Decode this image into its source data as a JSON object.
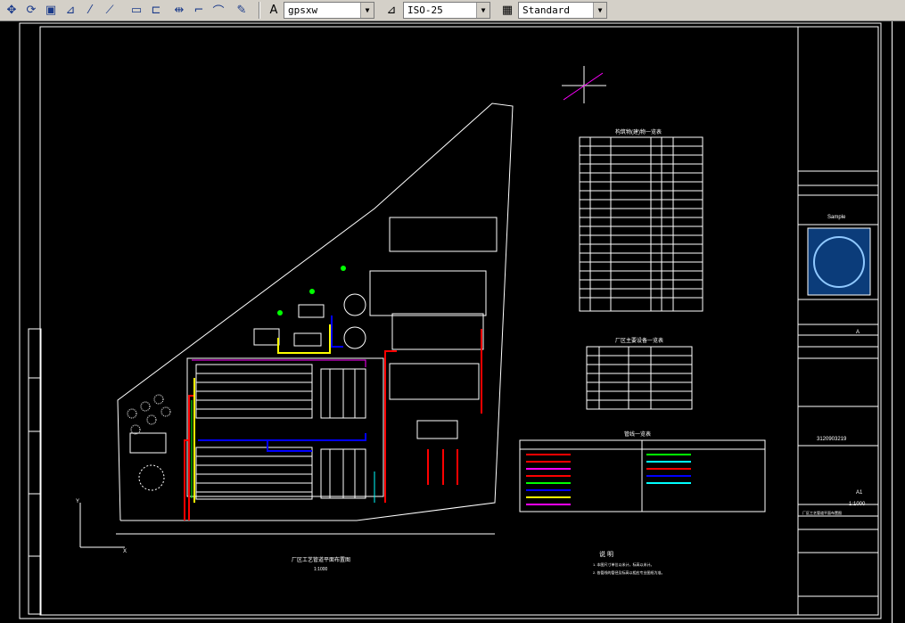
{
  "toolbar": {
    "icons": [
      "pan-icon",
      "orbit-icon",
      "region-icon",
      "measure-icon",
      "line-icon",
      "polyline-icon",
      "rectangle-icon",
      "rectangle-alt-icon",
      "trim-icon",
      "extend-icon",
      "arc-icon",
      "paint-icon"
    ],
    "text_style": "gpsxw",
    "dim_style": "ISO-25",
    "table_style": "Standard"
  },
  "drawing": {
    "title": "厂区工艺管道平面布置图",
    "scale": "1:1000",
    "legend_title": "管线一览表",
    "structures_title": "构筑物(建)物一览表",
    "equipment_title": "厂区主要设备一览表",
    "notes_title": "说 明",
    "note_1": "1. 本图尺寸单位以米计，标高以米计。",
    "note_2": "2. 各管线的管径及标高以相应专业图纸为准。",
    "title_block": {
      "company": "Sample",
      "drawing_no": "3120903219",
      "sheet_size": "A1",
      "scale": "1:1000",
      "project": "厂区工艺管道平面布置图",
      "section_a": "A"
    }
  },
  "colors": {
    "bg": "#000000",
    "line": "#ffffff",
    "pipe_red": "#ff0000",
    "pipe_blue": "#0000ff",
    "pipe_yellow": "#ffff00",
    "pipe_green": "#00ff00",
    "pipe_magenta": "#ff00ff",
    "pipe_cyan": "#00ffff"
  }
}
